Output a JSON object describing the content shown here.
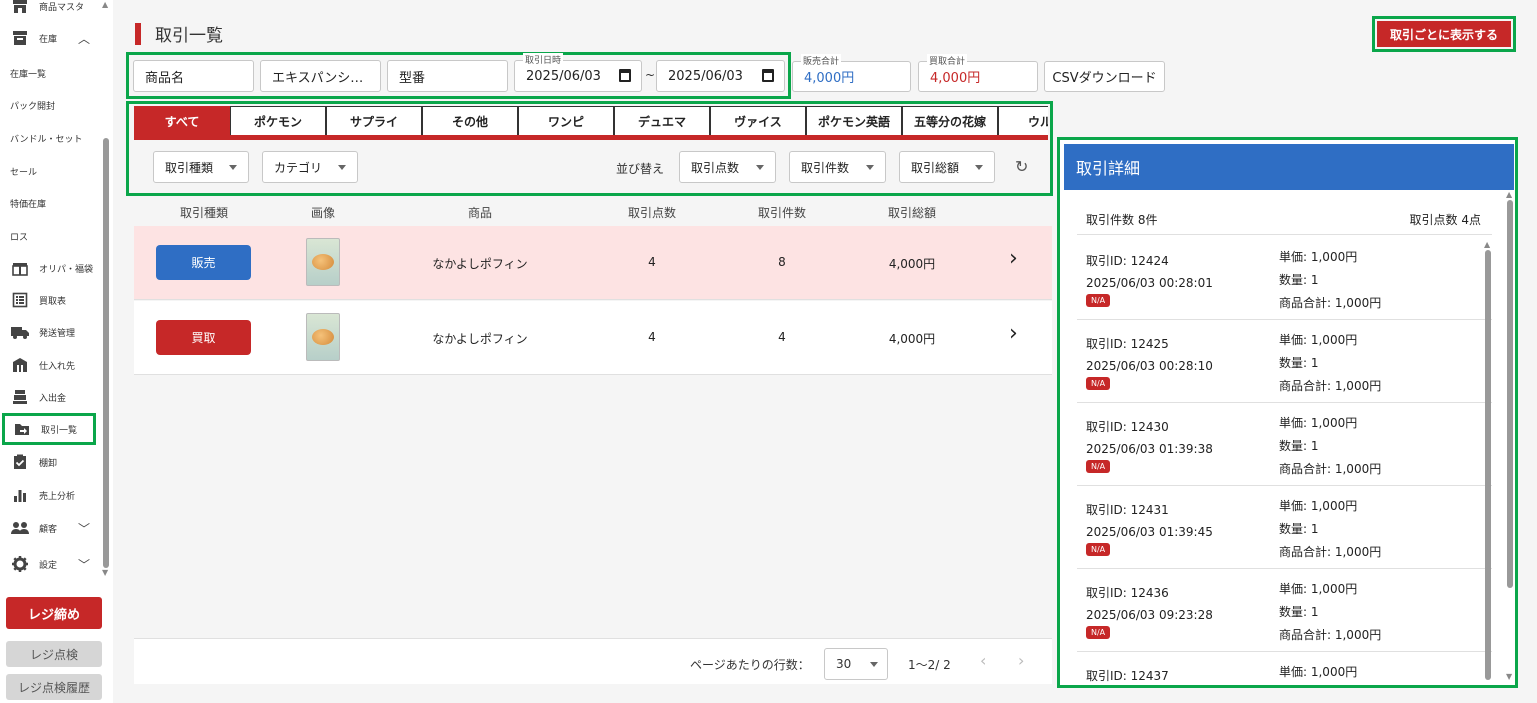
{
  "sidebar": {
    "items": [
      {
        "label": "商品マスタ",
        "icon": "store-icon"
      },
      {
        "label": "在庫",
        "icon": "archive-icon"
      },
      {
        "label": "在庫一覧"
      },
      {
        "label": "パック開封"
      },
      {
        "label": "バンドル・セット"
      },
      {
        "label": "セール"
      },
      {
        "label": "特価在庫"
      },
      {
        "label": "ロス"
      },
      {
        "label": "オリパ・福袋",
        "icon": "gift-box-icon"
      },
      {
        "label": "買取表",
        "icon": "list-icon"
      },
      {
        "label": "発送管理",
        "icon": "truck-icon"
      },
      {
        "label": "仕入れ先",
        "icon": "factory-icon"
      },
      {
        "label": "入出金",
        "icon": "cash-register-icon"
      },
      {
        "label": "取引一覧",
        "icon": "folder-arrow-icon"
      },
      {
        "label": "棚卸",
        "icon": "clipboard-check-icon"
      },
      {
        "label": "売上分析",
        "icon": "bar-chart-icon"
      },
      {
        "label": "顧客",
        "icon": "people-icon"
      },
      {
        "label": "設定",
        "icon": "gear-icon"
      }
    ],
    "close_register": "レジ締め",
    "register_check": "レジ点検",
    "register_check_history": "レジ点検履歴"
  },
  "page": {
    "title": "取引一覧",
    "group_button": "取引ごとに表示する"
  },
  "filters": {
    "product_name": "商品名",
    "expansion": "エキスパンシ…",
    "model": "型番",
    "date_label": "取引日時",
    "date_from": "2025/06/03",
    "date_to": "2025/06/03",
    "tilde": "~",
    "sales_total_label": "販売合計",
    "sales_total": "4,000円",
    "purchase_total_label": "買取合計",
    "purchase_total": "4,000円",
    "csv_button": "CSVダウンロード"
  },
  "tabs": [
    "すべて",
    "ポケモン",
    "サプライ",
    "その他",
    "ワンピ",
    "デュエマ",
    "ヴァイス",
    "ポケモン英語",
    "五等分の花嫁",
    "ウルト"
  ],
  "controls": {
    "type_select": "取引種類",
    "category_select": "カテゴリ",
    "sort_label": "並び替え",
    "sort_points": "取引点数",
    "sort_count": "取引件数",
    "sort_total": "取引総額"
  },
  "table": {
    "headers": [
      "取引種類",
      "画像",
      "商品",
      "取引点数",
      "取引件数",
      "取引総額"
    ],
    "rows": [
      {
        "type": "販売",
        "product": "なかよしポフィン",
        "points": "4",
        "count": "8",
        "total": "4,000円"
      },
      {
        "type": "買取",
        "product": "なかよしポフィン",
        "points": "4",
        "count": "4",
        "total": "4,000円"
      }
    ]
  },
  "pagination": {
    "rows_label": "ページあたりの行数：",
    "rows_value": "30",
    "range": "1〜2/ 2"
  },
  "detail": {
    "title": "取引詳細",
    "count_summary": "取引件数 8件",
    "points_summary": "取引点数 4点",
    "entries": [
      {
        "id": "取引ID: 12424",
        "datetime": "2025/06/03 00:28:01",
        "badge": "N/A",
        "unit_price": "単価: 1,000円",
        "qty": "数量: 1",
        "subtotal": "商品合計: 1,000円"
      },
      {
        "id": "取引ID: 12425",
        "datetime": "2025/06/03 00:28:10",
        "badge": "N/A",
        "unit_price": "単価: 1,000円",
        "qty": "数量: 1",
        "subtotal": "商品合計: 1,000円"
      },
      {
        "id": "取引ID: 12430",
        "datetime": "2025/06/03 01:39:38",
        "badge": "N/A",
        "unit_price": "単価: 1,000円",
        "qty": "数量: 1",
        "subtotal": "商品合計: 1,000円"
      },
      {
        "id": "取引ID: 12431",
        "datetime": "2025/06/03 01:39:45",
        "badge": "N/A",
        "unit_price": "単価: 1,000円",
        "qty": "数量: 1",
        "subtotal": "商品合計: 1,000円"
      },
      {
        "id": "取引ID: 12436",
        "datetime": "2025/06/03 09:23:28",
        "badge": "N/A",
        "unit_price": "単価: 1,000円",
        "qty": "数量: 1",
        "subtotal": "商品合計: 1,000円"
      },
      {
        "id": "取引ID: 12437",
        "datetime": "",
        "badge": "",
        "unit_price": "単価: 1,000円",
        "qty": "",
        "subtotal": ""
      }
    ]
  },
  "colors": {
    "brand_red": "#c62828",
    "accent_blue": "#2f6ec4",
    "highlight_green": "#0aa64a",
    "selected_row": "#fde3e3"
  }
}
